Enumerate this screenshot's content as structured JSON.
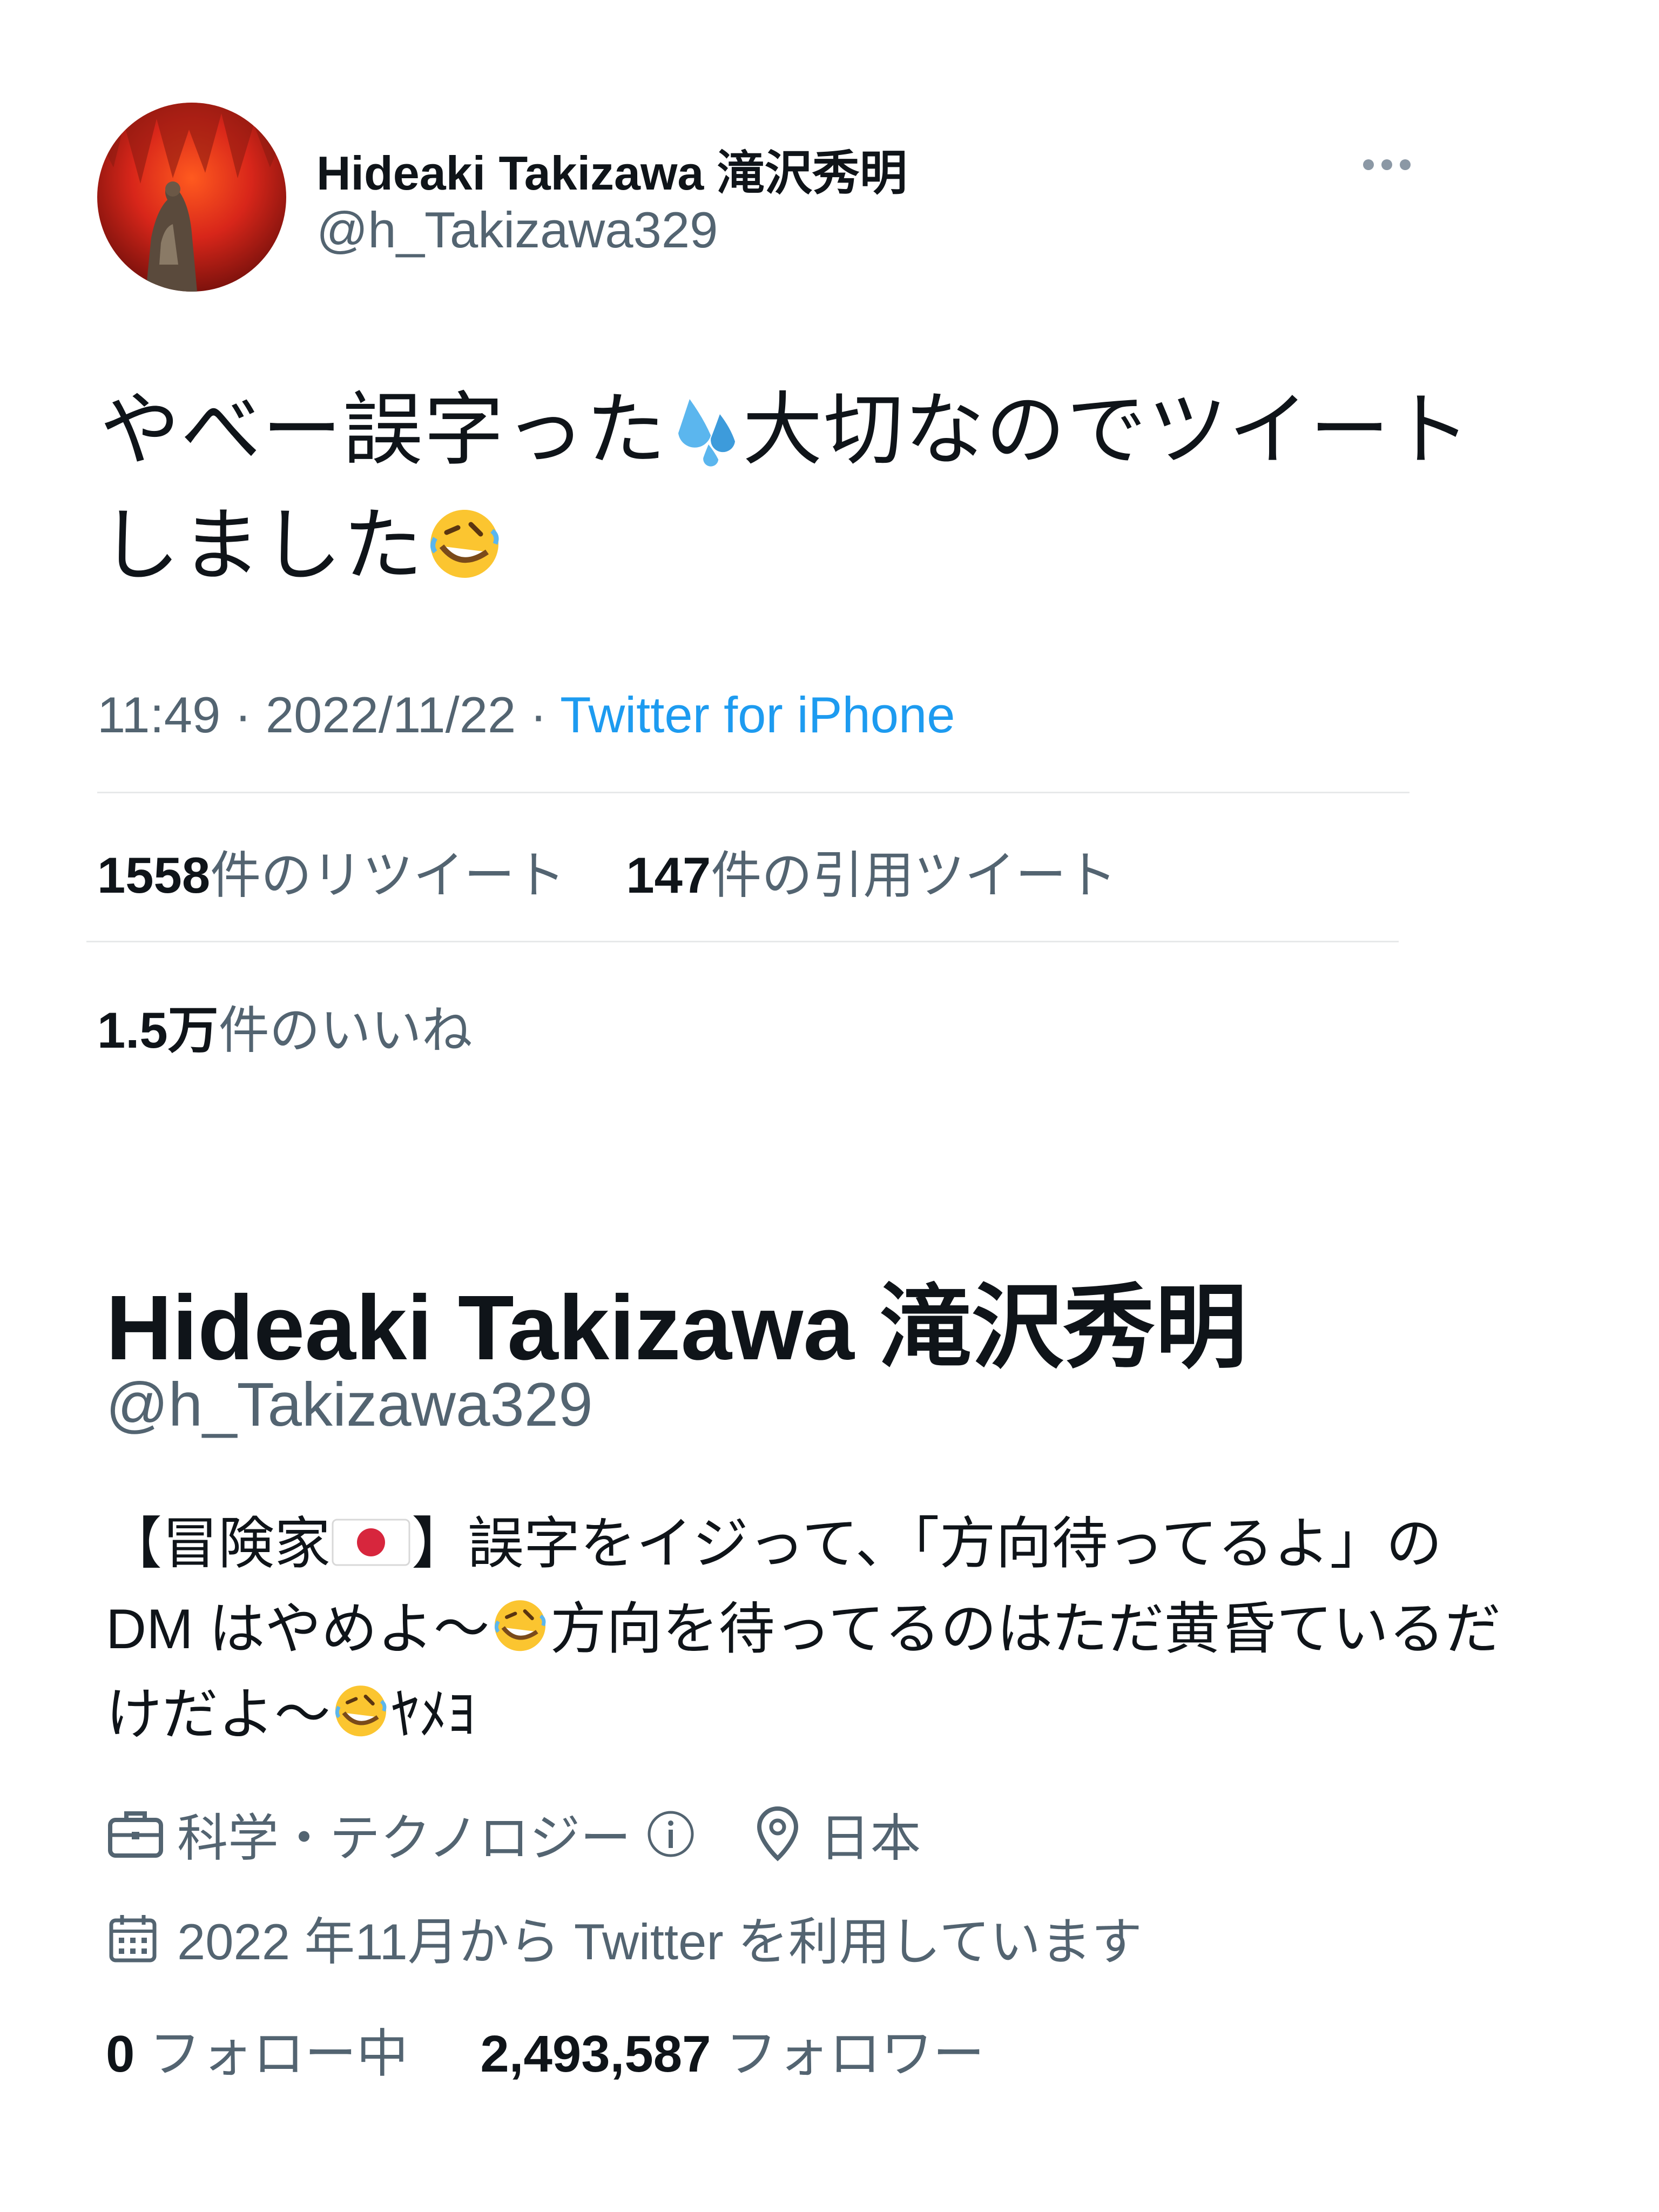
{
  "tweet": {
    "author_name": "Hideaki Takizawa 滝沢秀明",
    "author_handle": "@h_Takizawa329",
    "text_line1_a": "やべー誤字った",
    "text_line1_b": "大切なのでツイート",
    "text_line2": "しました",
    "time": "11:49",
    "date": "2022/11/22",
    "separator": " · ",
    "source": "Twitter for iPhone",
    "retweets_count": "1558",
    "retweets_label": "件のリツイート",
    "quotes_count": "147",
    "quotes_label": "件の引用ツイート",
    "likes_count": "1.5万",
    "likes_label": "件のいいね"
  },
  "profile": {
    "name": "Hideaki Takizawa 滝沢秀明",
    "handle": "@h_Takizawa329",
    "bio_1": "【冒険家",
    "bio_2": "】誤字をイジって、「方向待ってるよ」の",
    "bio_3": "DM はやめよ〜",
    "bio_4": "方向を待ってるのはただ黄昏ているだ",
    "bio_5": "けだよ〜",
    "bio_6": "ﾔﾒﾖ",
    "category": "科学・テクノロジー",
    "location": "日本",
    "joined": "2022 年11月から Twitter を利用しています",
    "following_count": "0",
    "following_label": "フォロー中",
    "followers_count": "2,493,587",
    "followers_label": "フォロワー"
  },
  "icons": [
    "more-icon",
    "sweat-droplets-emoji",
    "rofl-emoji",
    "japan-flag-emoji",
    "briefcase-icon",
    "info-icon",
    "location-pin-icon",
    "calendar-icon"
  ],
  "colors": {
    "link": "#1d9bf0",
    "secondary_text": "#536471",
    "primary_text": "#0f1419",
    "divider": "#e7e9ea"
  }
}
